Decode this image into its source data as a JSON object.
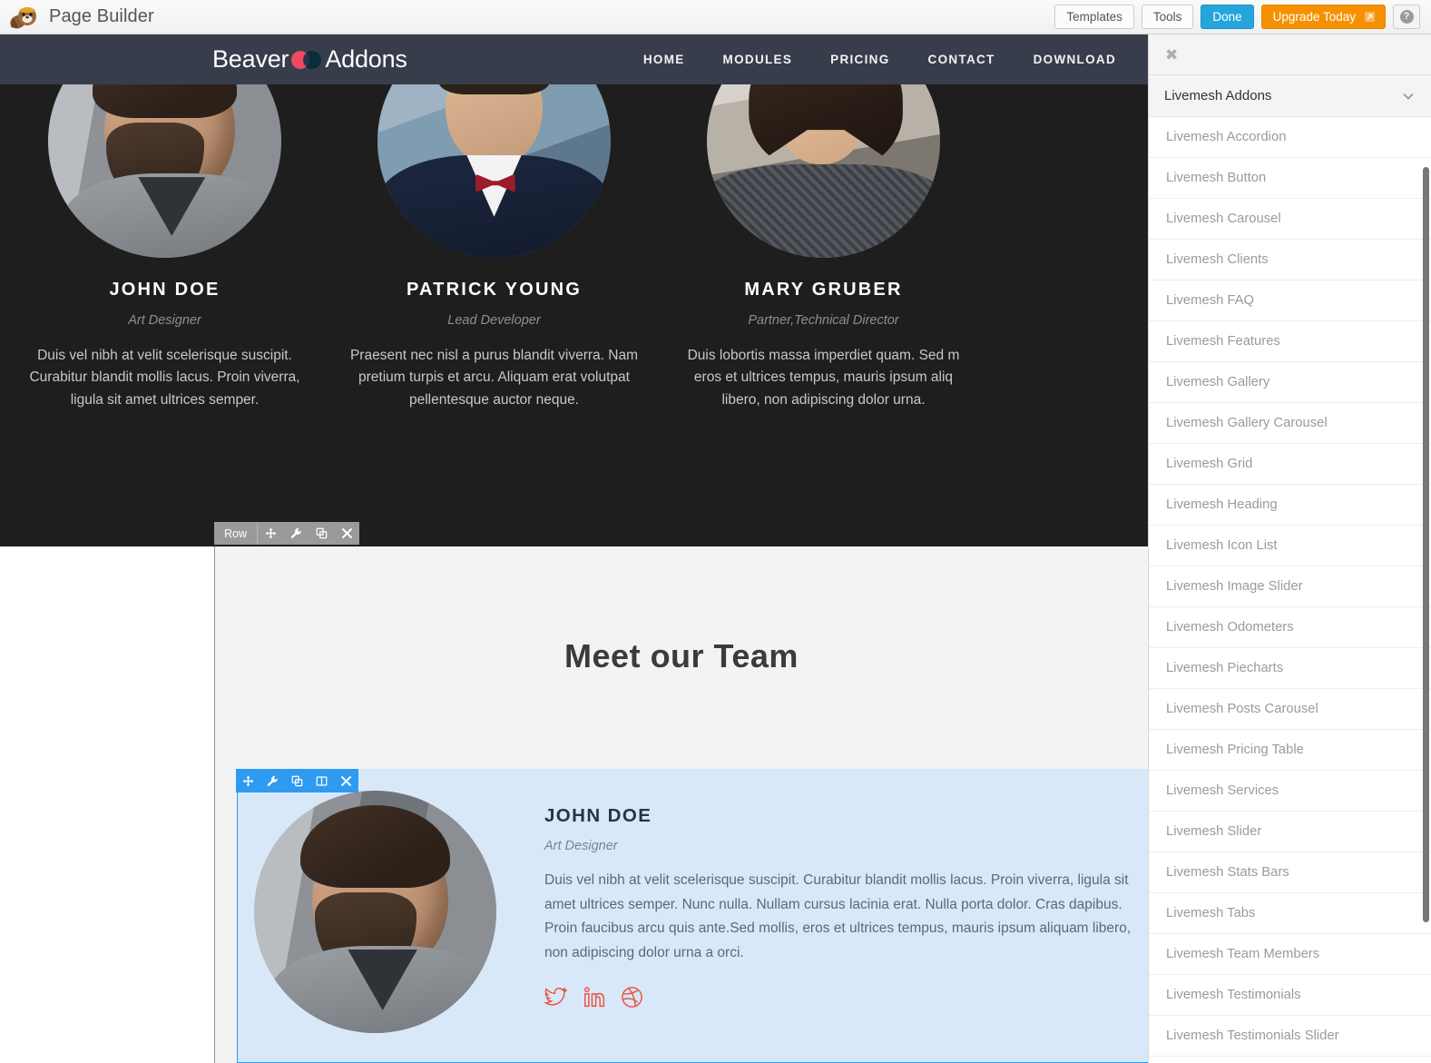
{
  "admin": {
    "logo_icon": "beaver-logo-icon",
    "title": "Page Builder",
    "buttons": {
      "templates": "Templates",
      "tools": "Tools",
      "done": "Done",
      "upgrade": "Upgrade Today",
      "upgrade_icon": "external-link-icon",
      "help_icon": "question-mark-icon",
      "help_glyph": "?"
    },
    "colors": {
      "done_bg": "#26a5dd",
      "upgrade_bg": "#f59100",
      "bar_bg": "#f0f0f0"
    }
  },
  "site": {
    "logo": {
      "word1": "Beaver",
      "word2": "Addons",
      "mark": "two-overlapping-circles-icon"
    },
    "nav": [
      {
        "label": "HOME"
      },
      {
        "label": "MODULES"
      },
      {
        "label": "PRICING"
      },
      {
        "label": "CONTACT"
      },
      {
        "label": "DOWNLOAD"
      }
    ],
    "nav_bg": "#383d4b"
  },
  "dark_section": {
    "bg": "#1e1e1e",
    "members": [
      {
        "name": "JOHN DOE",
        "role": "Art Designer",
        "desc": "Duis vel nibh at velit scelerisque suscipit. Curabitur blandit mollis lacus. Proin viverra, ligula sit amet ultrices semper.",
        "photo": "portrait-john-doe"
      },
      {
        "name": "PATRICK YOUNG",
        "role": "Lead Developer",
        "desc": "Praesent nec nisl a purus blandit viverra. Nam pretium turpis et arcu. Aliquam erat volutpat pellentesque auctor neque.",
        "photo": "portrait-patrick-young"
      },
      {
        "name": "MARY GRUBER",
        "role": "Partner,Technical Director",
        "desc": "Duis lobortis massa imperdiet quam. Sed m eros et ultrices tempus, mauris ipsum aliq libero, non adipiscing dolor urna.",
        "photo": "portrait-mary-gruber"
      }
    ]
  },
  "row_toolbar": {
    "label": "Row",
    "buttons": [
      {
        "name": "move-row-icon"
      },
      {
        "name": "settings-wrench-icon"
      },
      {
        "name": "duplicate-row-icon"
      },
      {
        "name": "delete-row-icon"
      }
    ]
  },
  "module_toolbar": {
    "buttons": [
      {
        "name": "move-module-icon"
      },
      {
        "name": "settings-wrench-icon"
      },
      {
        "name": "duplicate-module-icon"
      },
      {
        "name": "column-settings-icon"
      },
      {
        "name": "delete-module-icon"
      }
    ],
    "accent": "#2e9bf0"
  },
  "content": {
    "heading": "Meet our Team",
    "module": {
      "photo": "portrait-john-doe",
      "name": "JOHN DOE",
      "role": "Art Designer",
      "desc": "Duis vel nibh at velit scelerisque suscipit. Curabitur blandit mollis lacus. Proin viverra, ligula sit amet ultrices semper. Nunc nulla. Nullam cursus lacinia erat. Nulla porta dolor. Cras dapibus. Proin faucibus arcu quis ante.Sed mollis, eros et ultrices tempus, mauris ipsum aliquam libero, non adipiscing dolor urna a orci.",
      "social": [
        {
          "name": "twitter-icon"
        },
        {
          "name": "linkedin-icon"
        },
        {
          "name": "dribbble-icon"
        }
      ],
      "social_color": "#e8563f",
      "highlight_bg": "#d9e8f8"
    }
  },
  "panel": {
    "close_icon": "close-panel-icon",
    "close_glyph": "✖",
    "group": {
      "label": "Livemesh Addons",
      "chevron": "chevron-down-icon"
    },
    "items": [
      {
        "label": "Livemesh Accordion"
      },
      {
        "label": "Livemesh Button"
      },
      {
        "label": "Livemesh Carousel"
      },
      {
        "label": "Livemesh Clients"
      },
      {
        "label": "Livemesh FAQ"
      },
      {
        "label": "Livemesh Features"
      },
      {
        "label": "Livemesh Gallery"
      },
      {
        "label": "Livemesh Gallery Carousel"
      },
      {
        "label": "Livemesh Grid"
      },
      {
        "label": "Livemesh Heading"
      },
      {
        "label": "Livemesh Icon List"
      },
      {
        "label": "Livemesh Image Slider"
      },
      {
        "label": "Livemesh Odometers"
      },
      {
        "label": "Livemesh Piecharts"
      },
      {
        "label": "Livemesh Posts Carousel"
      },
      {
        "label": "Livemesh Pricing Table"
      },
      {
        "label": "Livemesh Services"
      },
      {
        "label": "Livemesh Slider"
      },
      {
        "label": "Livemesh Stats Bars"
      },
      {
        "label": "Livemesh Tabs"
      },
      {
        "label": "Livemesh Team Members"
      },
      {
        "label": "Livemesh Testimonials"
      },
      {
        "label": "Livemesh Testimonials Slider"
      }
    ]
  }
}
